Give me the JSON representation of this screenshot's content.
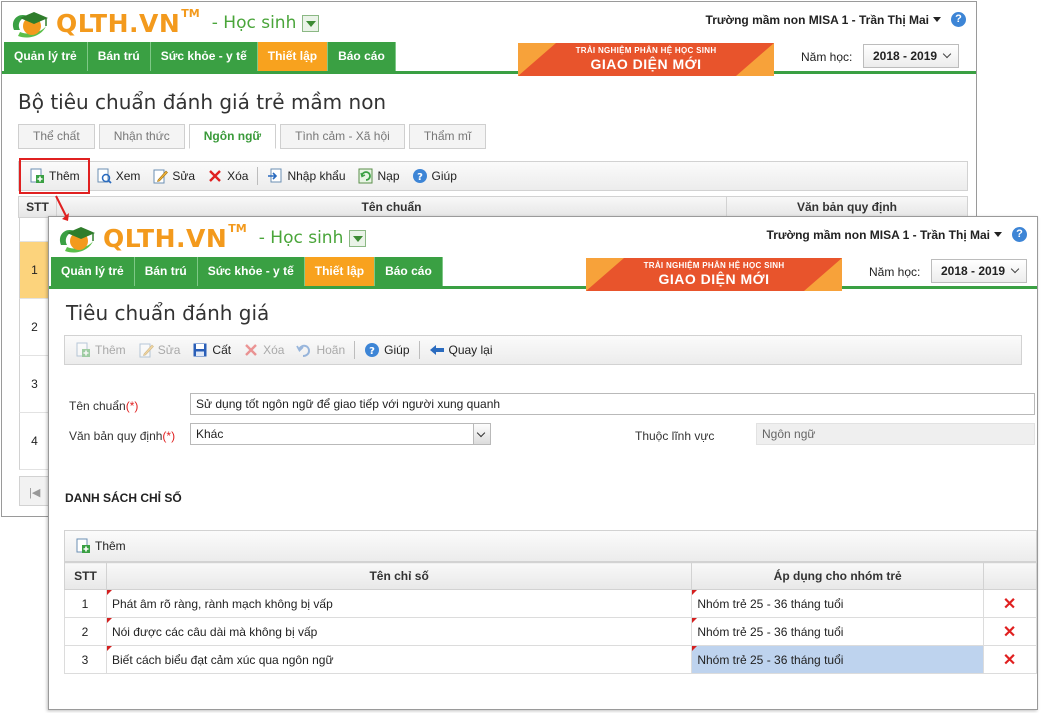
{
  "brand": {
    "name": "QLTH.VN",
    "tm": "TM",
    "role": "- Học sinh"
  },
  "header": {
    "school": "Trường mầm non MISA 1 - Trần Thị Mai",
    "help": "?"
  },
  "menu": [
    "Quản lý trẻ",
    "Bán trú",
    "Sức khỏe - y tế",
    "Thiết lập",
    "Báo cáo"
  ],
  "banner": {
    "line1": "TRẢI NGHIỆM PHÂN HỆ HỌC SINH",
    "line2": "GIAO DIỆN MỚI"
  },
  "year": {
    "label": "Năm học:",
    "value": "2018 - 2019"
  },
  "back": {
    "title": "Bộ tiêu chuẩn đánh giá trẻ mầm non",
    "tabs": [
      "Thể chất",
      "Nhận thức",
      "Ngôn ngữ",
      "Tình cảm - Xã hội",
      "Thẩm mĩ"
    ],
    "toolbar": {
      "add": "Thêm",
      "view": "Xem",
      "edit": "Sửa",
      "delete": "Xóa",
      "import": "Nhập khẩu",
      "reload": "Nạp",
      "help": "Giúp"
    },
    "grid": {
      "col_stt": "STT",
      "col_name": "Tên chuẩn",
      "col_doc": "Văn bản quy định",
      "rows": [
        "1",
        "2",
        "3",
        "4"
      ]
    }
  },
  "front": {
    "title": "Tiêu chuẩn đánh giá",
    "toolbar": {
      "add": "Thêm",
      "edit": "Sửa",
      "save": "Cất",
      "delete": "Xóa",
      "undo": "Hoãn",
      "help": "Giúp",
      "back": "Quay lại"
    },
    "form": {
      "name_label": "Tên chuẩn",
      "name_value": "Sử dụng tốt ngôn ngữ để giao tiếp với người xung quanh",
      "doc_label": "Văn bản quy định",
      "doc_value": "Khác",
      "field_label": "Thuộc lĩnh vực",
      "field_value": "Ngôn ngữ",
      "required": "(*)"
    },
    "indicators": {
      "section_title": "DANH SÁCH CHỈ SỐ",
      "add": "Thêm",
      "col_stt": "STT",
      "col_name": "Tên chỉ số",
      "col_group": "Áp dụng cho nhóm trẻ",
      "rows": [
        {
          "stt": "1",
          "name": "Phát âm rõ ràng, rành mạch không bị vấp",
          "group": "Nhóm trẻ 25 - 36 tháng tuổi"
        },
        {
          "stt": "2",
          "name": "Nói được các câu dài mà không bị vấp",
          "group": "Nhóm trẻ 25 - 36 tháng tuổi"
        },
        {
          "stt": "3",
          "name": "Biết cách biểu đạt cảm xúc qua ngôn ngữ",
          "group": "Nhóm trẻ 25 - 36 tháng tuổi"
        }
      ]
    }
  },
  "colors": {
    "green": "#3aa043",
    "orange": "#f8a21e",
    "red": "#e02020",
    "selected_row": "#fcd37c",
    "highlight_cell": "#bed3ee"
  }
}
